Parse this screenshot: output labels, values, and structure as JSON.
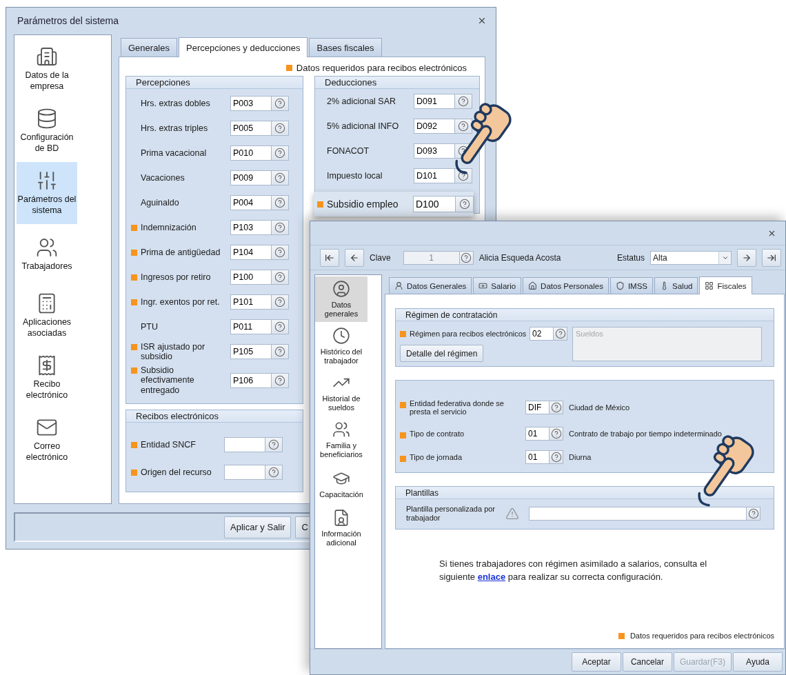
{
  "back_window": {
    "title": "Parámetros del sistema",
    "sidebar": [
      {
        "label": "Datos de la empresa",
        "selected": false
      },
      {
        "label": "Configuración de BD",
        "selected": false
      },
      {
        "label": "Parámetros del sistema",
        "selected": true
      },
      {
        "label": "Trabajadores",
        "selected": false
      },
      {
        "label": "Aplicaciones asociadas",
        "selected": false
      },
      {
        "label": "Recibo electrónico",
        "selected": false
      },
      {
        "label": "Correo electrónico",
        "selected": false
      }
    ],
    "tabs": [
      {
        "label": "Generales",
        "selected": false
      },
      {
        "label": "Percepciones y deducciones",
        "selected": true
      },
      {
        "label": "Bases fiscales",
        "selected": false
      }
    ],
    "legend": "Datos requeridos para recibos electrónicos",
    "percepciones": {
      "title": "Percepciones",
      "rows": [
        {
          "label": "Hrs. extras dobles",
          "code": "P003",
          "required": false
        },
        {
          "label": "Hrs. extras triples",
          "code": "P005",
          "required": false
        },
        {
          "label": "Prima vacacional",
          "code": "P010",
          "required": false
        },
        {
          "label": "Vacaciones",
          "code": "P009",
          "required": false
        },
        {
          "label": "Aguinaldo",
          "code": "P004",
          "required": false
        },
        {
          "label": "Indemnización",
          "code": "P103",
          "required": true
        },
        {
          "label": "Prima de antigüedad",
          "code": "P104",
          "required": true
        },
        {
          "label": "Ingresos por retiro",
          "code": "P100",
          "required": true
        },
        {
          "label": "Ingr. exentos por ret.",
          "code": "P101",
          "required": true
        },
        {
          "label": "PTU",
          "code": "P011",
          "required": false
        },
        {
          "label": "ISR ajustado por subsidio",
          "code": "P105",
          "required": true
        },
        {
          "label": "Subsidio efectivamente entregado",
          "code": "P106",
          "required": true
        }
      ]
    },
    "deducciones": {
      "title": "Deducciones",
      "rows": [
        {
          "label": "2% adicional SAR",
          "code": "D091",
          "required": false
        },
        {
          "label": "5% adicional INFO",
          "code": "D092",
          "required": false
        },
        {
          "label": "FONACOT",
          "code": "D093",
          "required": false
        },
        {
          "label": "Impuesto local",
          "code": "D101",
          "required": false
        }
      ]
    },
    "recibos": {
      "title": "Recibos electrónicos",
      "rows": [
        {
          "label": "Entidad SNCF",
          "required": true
        },
        {
          "label": "Origen del recurso",
          "required": true
        }
      ]
    },
    "zoomed_row": {
      "label": "Subsidio empleo",
      "code": "D100",
      "required": true
    },
    "buttons": [
      "Aplicar y Salir",
      "C"
    ]
  },
  "front_window": {
    "toolbar": {
      "key_label": "Clave",
      "key_value": "1",
      "employee": "Alicia Esqueda Acosta",
      "status_label": "Estatus",
      "status_value": "Alta"
    },
    "sidebar": [
      {
        "label": "Datos generales",
        "selected": true
      },
      {
        "label": "Histórico del trabajador",
        "selected": false
      },
      {
        "label": "Historial de sueldos",
        "selected": false
      },
      {
        "label": "Familia y beneficiarios",
        "selected": false
      },
      {
        "label": "Capacitación",
        "selected": false
      },
      {
        "label": "Información adicional",
        "selected": false
      }
    ],
    "tabs": [
      {
        "label": "Datos Generales",
        "selected": false
      },
      {
        "label": "Salario",
        "selected": false
      },
      {
        "label": "Datos Personales",
        "selected": false
      },
      {
        "label": "IMSS",
        "selected": false
      },
      {
        "label": "Salud",
        "selected": false
      },
      {
        "label": "Fiscales",
        "selected": true
      }
    ],
    "regimen": {
      "title": "Régimen de contratación",
      "label": "Régimen para recibos electrónicos",
      "code": "02",
      "description": "Sueldos",
      "required": true,
      "button": "Detalle del régimen"
    },
    "fiscal_rows": [
      {
        "label": "Entidad federativa donde se presta el servicio",
        "code": "DIF",
        "description": "Ciudad de México",
        "required": true
      },
      {
        "label": "Tipo de contrato",
        "code": "01",
        "description": "Contrato de trabajo por tiempo indeterminado",
        "required": true
      },
      {
        "label": "Tipo de jornada",
        "code": "01",
        "description": "Diurna",
        "required": true
      }
    ],
    "plantillas": {
      "title": "Plantillas",
      "label": "Plantilla personalizada por trabajador"
    },
    "note": {
      "before": "Si tienes trabajadores con régimen asimilado a salarios, consulta el siguiente ",
      "link": "enlace",
      "after": " para realizar su correcta configuración."
    },
    "legend": "Datos requeridos para recibos electrónicos",
    "buttons": [
      {
        "label": "Aceptar",
        "disabled": false
      },
      {
        "label": "Cancelar",
        "disabled": false
      },
      {
        "label": "Guardar(F3)",
        "disabled": true
      },
      {
        "label": "Ayuda",
        "disabled": false
      }
    ]
  }
}
